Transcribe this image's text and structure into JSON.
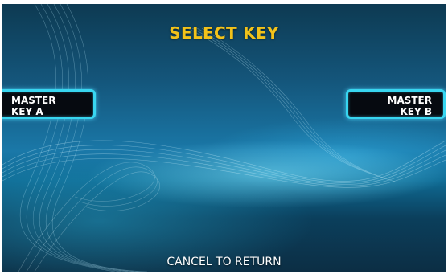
{
  "screen": {
    "title": "SELECT KEY",
    "footer": "CANCEL TO RETURN"
  },
  "buttons": {
    "left": {
      "line1": "MASTER",
      "line2": "KEY A"
    },
    "right": {
      "line1": "MASTER",
      "line2": "KEY B"
    }
  },
  "colors": {
    "title": "#f2c21a",
    "button_border": "#38d6f0",
    "button_fill": "#060a10"
  }
}
